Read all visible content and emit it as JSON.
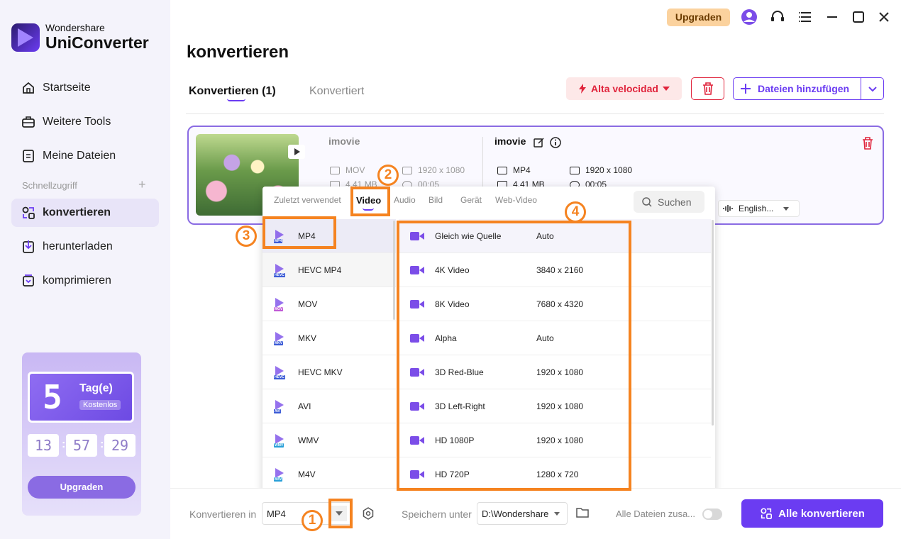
{
  "app": {
    "brand_line1": "Wondershare",
    "brand_line2": "UniConverter"
  },
  "sidebar": {
    "items": [
      {
        "label": "Startseite"
      },
      {
        "label": "Weitere Tools"
      },
      {
        "label": "Meine Dateien"
      }
    ],
    "quick_access_label": "Schnellzugriff",
    "quick_items": [
      {
        "label": "konvertieren",
        "active": true
      },
      {
        "label": "herunterladen"
      },
      {
        "label": "komprimieren"
      }
    ],
    "trial": {
      "days_number": "5",
      "days_label": "Tag(e)",
      "free_label": "Kostenlos",
      "hours": "13",
      "minutes": "57",
      "seconds": "29",
      "button_label": "Upgraden"
    }
  },
  "topbar": {
    "upgrade_label": "Upgraden"
  },
  "page": {
    "title": "konvertieren",
    "tabs": [
      {
        "label": "Konvertieren (1)",
        "active": true
      },
      {
        "label": "Konvertiert",
        "active": false
      }
    ],
    "speed_label": "Alta velocidad",
    "add_files_label": "Dateien hinzufügen"
  },
  "file": {
    "source": {
      "name": "imovie",
      "format": "MOV",
      "resolution": "1920 x 1080",
      "size": "4.41 MB",
      "duration": "00:05"
    },
    "target": {
      "name": "imovie",
      "format": "MP4",
      "resolution": "1920 x 1080",
      "size": "4.41 MB",
      "duration": "00:05"
    },
    "audio_language": "English..."
  },
  "format_dropdown": {
    "tabs": [
      {
        "label": "Zuletzt verwendet"
      },
      {
        "label": "Video",
        "active": true
      },
      {
        "label": "Audio"
      },
      {
        "label": "Bild"
      },
      {
        "label": "Gerät"
      },
      {
        "label": "Web-Video"
      }
    ],
    "search_placeholder": "Suchen",
    "formats": [
      {
        "label": "MP4",
        "tag": "MP4",
        "selected": true
      },
      {
        "label": "HEVC MP4",
        "tag": "HEVC"
      },
      {
        "label": "MOV",
        "tag": "MOV"
      },
      {
        "label": "MKV",
        "tag": "MKV"
      },
      {
        "label": "HEVC MKV",
        "tag": "HEVC"
      },
      {
        "label": "AVI",
        "tag": "AVI"
      },
      {
        "label": "WMV",
        "tag": "WMV"
      },
      {
        "label": "M4V",
        "tag": "M4V"
      }
    ],
    "resolutions": [
      {
        "name": "Gleich wie Quelle",
        "value": "Auto",
        "selected": true
      },
      {
        "name": "4K Video",
        "value": "3840 x 2160"
      },
      {
        "name": "8K Video",
        "value": "7680 x 4320"
      },
      {
        "name": "Alpha",
        "value": "Auto"
      },
      {
        "name": "3D Red-Blue",
        "value": "1920 x 1080"
      },
      {
        "name": "3D Left-Right",
        "value": "1920 x 1080"
      },
      {
        "name": "HD 1080P",
        "value": "1920 x 1080"
      },
      {
        "name": "HD 720P",
        "value": "1280 x 720"
      }
    ]
  },
  "bottom": {
    "convert_to_label": "Konvertieren in",
    "convert_to_value": "MP4",
    "save_label": "Speichern unter",
    "save_path": "D:\\Wondershare",
    "merge_label": "Alle Dateien zusa...",
    "convert_all_label": "Alle konvertieren"
  },
  "annotations": [
    "1",
    "2",
    "3",
    "4"
  ],
  "colors": {
    "accent": "#6b3cf2",
    "danger": "#e0243c",
    "annotation": "#f58320",
    "upgrade_bg": "#fbd29e"
  }
}
